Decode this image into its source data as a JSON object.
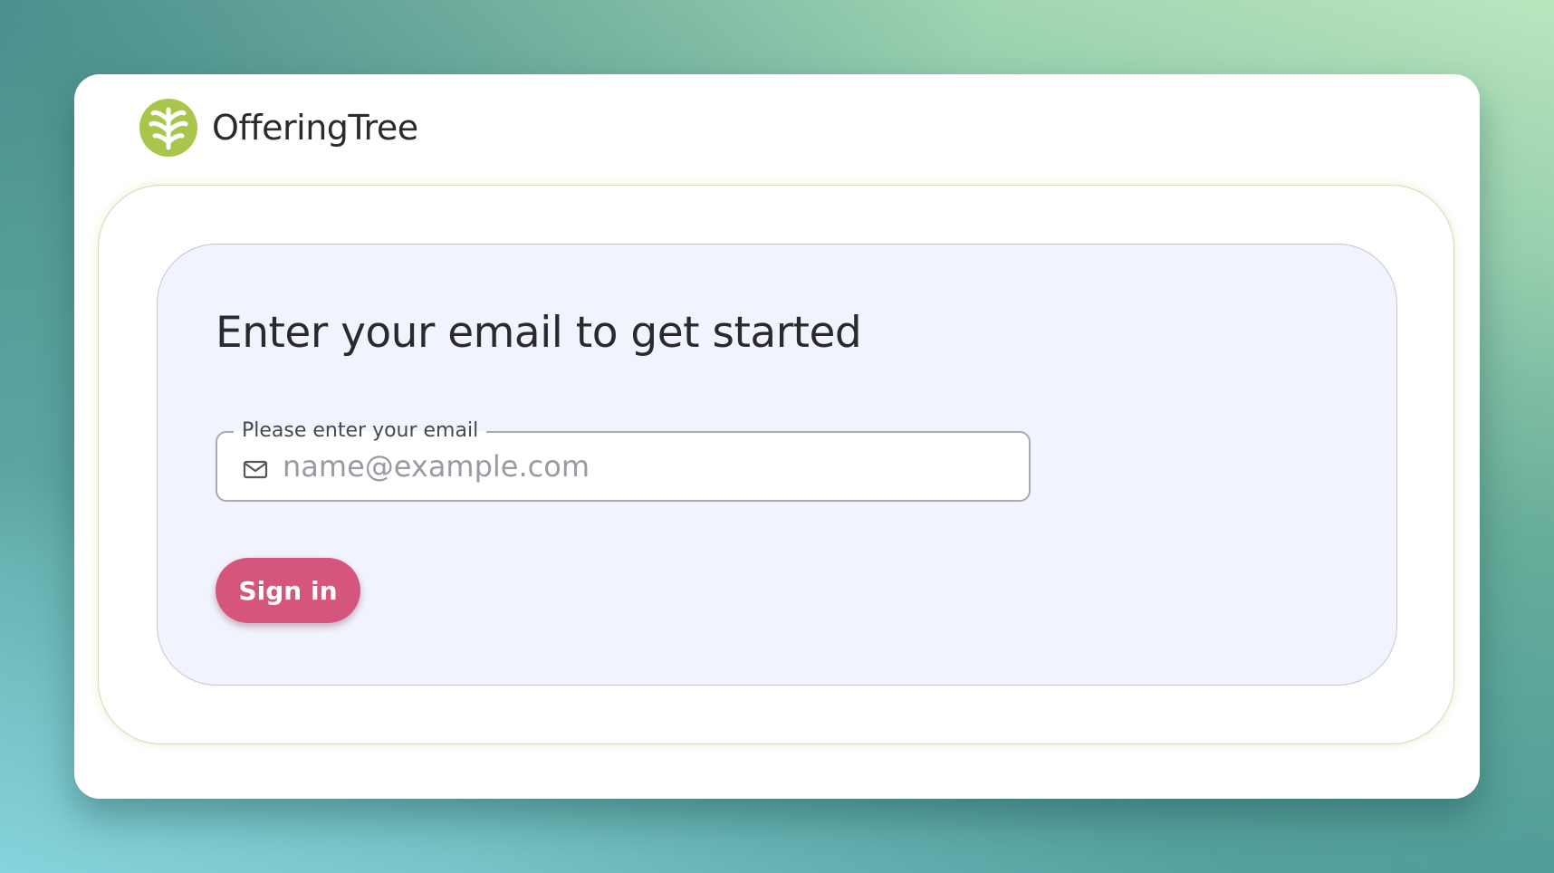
{
  "brand": {
    "name": "OfferingTree",
    "logo_icon": "tree-leaf-logo-icon",
    "logo_color": "#a8c74a"
  },
  "login": {
    "heading": "Enter your email to get started",
    "email_field": {
      "label": "Please enter your email",
      "placeholder": "name@example.com",
      "value": "",
      "icon": "mail-icon"
    },
    "signin_button": {
      "label": "Sign in",
      "color": "#d6557c"
    }
  },
  "colors": {
    "card_background": "#f1f4fe",
    "window_background": "#ffffff",
    "text": "#2a2a2e"
  }
}
